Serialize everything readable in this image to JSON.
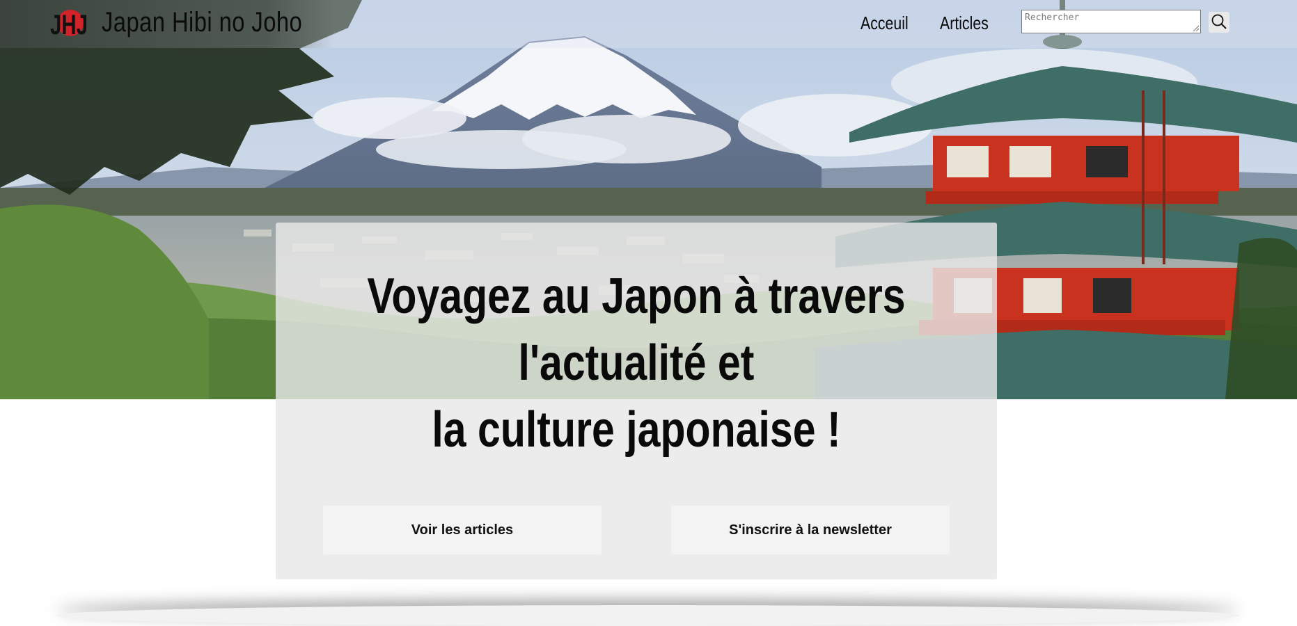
{
  "header": {
    "brand": "Japan Hibi no Joho",
    "logo_text": "JHJ",
    "nav": [
      {
        "label": "Acceuil"
      },
      {
        "label": "Articles"
      }
    ],
    "search": {
      "placeholder": "Rechercher",
      "icon": "search-icon"
    }
  },
  "hero": {
    "headline": [
      "Voyagez au Japon à travers",
      "l'actualité et",
      "la culture japonaise !"
    ],
    "buttons": [
      {
        "label": "Voir les articles"
      },
      {
        "label": "S'inscrire à la newsletter"
      }
    ]
  },
  "colors": {
    "logo_red": "#d2232a",
    "pagoda_red": "#c8321e",
    "roof_green": "#3f6e66",
    "panel_bg": "#e8e8e8",
    "button_bg": "#f3f3f3"
  }
}
